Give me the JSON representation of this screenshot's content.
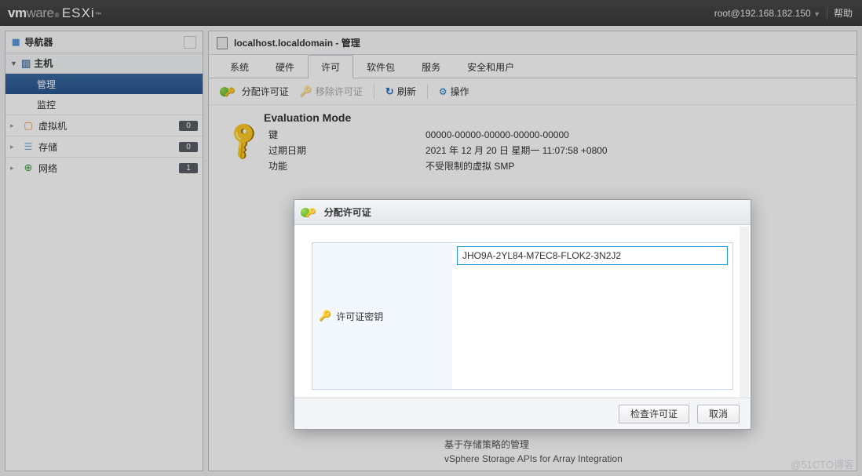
{
  "header": {
    "brand_vm": "vm",
    "brand_ware": "ware",
    "brand_esxi": "ESXi",
    "user": "root@192.168.182.150",
    "help": "帮助"
  },
  "sidebar": {
    "navigator": "导航器",
    "host": "主机",
    "manage": "管理",
    "monitor": "监控",
    "vm": {
      "label": "虚拟机",
      "count": "0",
      "icon_color": "#e88b2e"
    },
    "storage": {
      "label": "存储",
      "count": "0",
      "icon_color": "#6aa9e0"
    },
    "network": {
      "label": "网络",
      "count": "1",
      "icon_color": "#3b9b3b"
    }
  },
  "main": {
    "title": "localhost.localdomain - 管理",
    "tabs": [
      "系统",
      "硬件",
      "许可",
      "软件包",
      "服务",
      "安全和用户"
    ],
    "active_tab_index": 2,
    "tools": {
      "assign": "分配许可证",
      "remove": "移除许可证",
      "refresh": "刷新",
      "actions": "操作"
    },
    "license": {
      "mode": "Evaluation Mode",
      "rows": [
        {
          "label": "键",
          "value": "00000-00000-00000-00000-00000"
        },
        {
          "label": "过期日期",
          "value": "2021 年 12 月 20 日 星期一 11:07:58 +0800"
        },
        {
          "label": "功能",
          "value": "不受限制的虚拟 SMP"
        }
      ]
    },
    "bottom_lines": [
      "基于存储策略的管理",
      "vSphere Storage APIs for Array Integration"
    ]
  },
  "modal": {
    "title": "分配许可证",
    "field_label": "许可证密钥",
    "field_value": "JHO9A-2YL84-M7EC8-FLOK2-3N2J2",
    "btn_check": "检查许可证",
    "btn_cancel": "取消"
  },
  "watermark": "@51CTO博客"
}
